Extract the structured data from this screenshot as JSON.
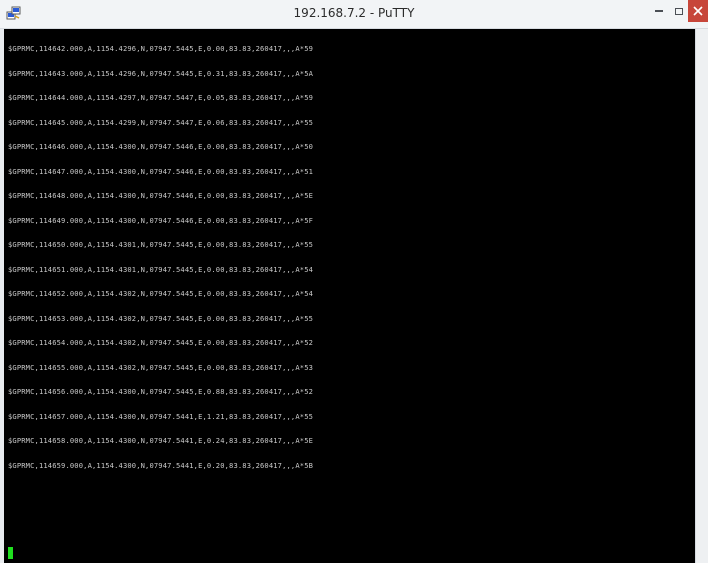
{
  "window": {
    "title": "192.168.7.2 - PuTTY",
    "app_icon": "putty-icon",
    "controls": [
      "minimize-icon",
      "maximize-icon",
      "close-icon"
    ]
  },
  "terminal": {
    "background": "#000000",
    "text_color": "#c9c9c9",
    "cursor_color": "#1fe01f",
    "lines": [
      "$GPRMC,114642.000,A,1154.4296,N,07947.5445,E,0.00,83.83,260417,,,A*59",
      "$GPRMC,114643.000,A,1154.4296,N,07947.5445,E,0.31,83.83,260417,,,A*5A",
      "$GPRMC,114644.000,A,1154.4297,N,07947.5447,E,0.05,83.83,260417,,,A*59",
      "$GPRMC,114645.000,A,1154.4299,N,07947.5447,E,0.06,83.83,260417,,,A*55",
      "$GPRMC,114646.000,A,1154.4300,N,07947.5446,E,0.00,83.83,260417,,,A*50",
      "$GPRMC,114647.000,A,1154.4300,N,07947.5446,E,0.00,83.83,260417,,,A*51",
      "$GPRMC,114648.000,A,1154.4300,N,07947.5446,E,0.00,83.83,260417,,,A*5E",
      "$GPRMC,114649.000,A,1154.4300,N,07947.5446,E,0.00,83.83,260417,,,A*5F",
      "$GPRMC,114650.000,A,1154.4301,N,07947.5445,E,0.00,83.83,260417,,,A*55",
      "$GPRMC,114651.000,A,1154.4301,N,07947.5445,E,0.00,83.83,260417,,,A*54",
      "$GPRMC,114652.000,A,1154.4302,N,07947.5445,E,0.00,83.83,260417,,,A*54",
      "$GPRMC,114653.000,A,1154.4302,N,07947.5445,E,0.00,83.83,260417,,,A*55",
      "$GPRMC,114654.000,A,1154.4302,N,07947.5445,E,0.00,83.83,260417,,,A*52",
      "$GPRMC,114655.000,A,1154.4302,N,07947.5445,E,0.00,83.83,260417,,,A*53",
      "$GPRMC,114656.000,A,1154.4300,N,07947.5445,E,0.88,83.83,260417,,,A*52",
      "$GPRMC,114657.000,A,1154.4300,N,07947.5441,E,1.21,83.83,260417,,,A*55",
      "$GPRMC,114658.000,A,1154.4300,N,07947.5441,E,0.24,83.83,260417,,,A*5E",
      "$GPRMC,114659.000,A,1154.4300,N,07947.5441,E,0.20,83.83,260417,,,A*5B"
    ]
  }
}
